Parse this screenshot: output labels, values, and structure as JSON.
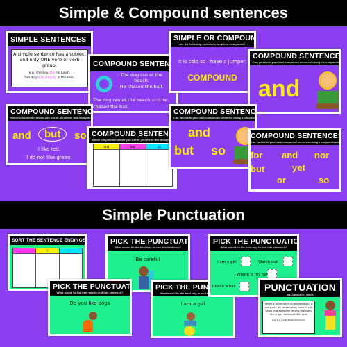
{
  "banners": {
    "top": "Simple & Compound sentences",
    "bottom": "Simple Punctuation"
  },
  "colors": {
    "purple": "#8c3ff2",
    "green": "#1ef08e",
    "yellow": "#f5f000",
    "pink": "#ff3df0",
    "cyan": "#00e5ff"
  },
  "slides": {
    "simple": {
      "title": "SIMPLE SENTENCES",
      "body": "A simple sentence has a subject and only ONE verb or verb group.",
      "ex1a": "e.g. The boy ",
      "ex1v": "ate",
      "ex1b": " his lunch.",
      "ex2a": "The dog ",
      "ex2v": "was playing",
      "ex2b": " in the mud."
    },
    "compound_arrow": {
      "title": "COMPOUND SENTENCES",
      "s1": "The dog ran at the beach.",
      "s2": "He chased the ball.",
      "c1": "The dog ran at the beach ",
      "cand": "and",
      "c2": " he chased the ball."
    },
    "simple_or_compound": {
      "title": "SIMPLE OR COMPOUND?",
      "subtitle": "Are the following sentences simple or compound?",
      "sentence": "It is cold so I have a jumper.",
      "answer": "COMPOUND"
    },
    "compound_and": {
      "title": "COMPOUND SENTENCES",
      "subtitle": "Can you write your own compound sentence using the conjunction below?",
      "word": "and"
    },
    "compound_choice": {
      "title": "COMPOUND SENTENCES",
      "subtitle": "Which conjunction would you use to join these two thoughts together?",
      "w1": "and",
      "w2": "but",
      "w3": "so",
      "s1": "I like red.",
      "s2": "I do not like green."
    },
    "compound_table": {
      "title": "COMPOUND SENTENCES",
      "subtitle": "Which conjunction would you use to join these two thoughts together?",
      "cols": [
        "and",
        "but",
        "so"
      ]
    },
    "compound_three": {
      "title": "COMPOUND SENTENCES",
      "subtitle": "Can you write your own compound sentence using a conjunction below?",
      "w1": "and",
      "w2": "but",
      "w3": "so"
    },
    "compound_fanboys": {
      "title": "COMPOUND SENTENCES",
      "subtitle": "Can you write your own compound sentence using a conjunction below?",
      "words": [
        "for",
        "and",
        "nor",
        "but",
        "yet",
        "or",
        "so"
      ]
    },
    "sort": {
      "title": "SORT THE SENTENCE ENDINGS",
      "cols": [
        ".",
        "?",
        "!"
      ]
    },
    "pick1": {
      "title": "PICK THE PUNCTUATION",
      "subtitle": "What would be the best way to end this sentence?",
      "sentence": "Be careful"
    },
    "pick2": {
      "title": "PICK THE PUNCTUATION",
      "subtitle": "What would be the best way to end this sentence?",
      "sentence": "Do you like dogs"
    },
    "pick3": {
      "title": "PICK THE PUNCTUATION",
      "subtitle": "What would be the best way to end this sentence?",
      "sentence": "I am a girl"
    },
    "pick4": {
      "title": "PICK THE PUNCTUATION",
      "subtitle": "What would be the best way to end this sentence?",
      "items": [
        "I am a girl",
        "Watch out",
        "Where is my hat",
        "I have a ball"
      ]
    },
    "punct": {
      "title": "PUNCTUATION",
      "subtitle": "Exclamation Mark",
      "body": "When a sentence is an exclamation, it ends with an exclamation mark. It can show that someone feeling emotions like anger, excitement or fear.",
      "example": "e.g. It is my birthday tomorrow!"
    }
  }
}
